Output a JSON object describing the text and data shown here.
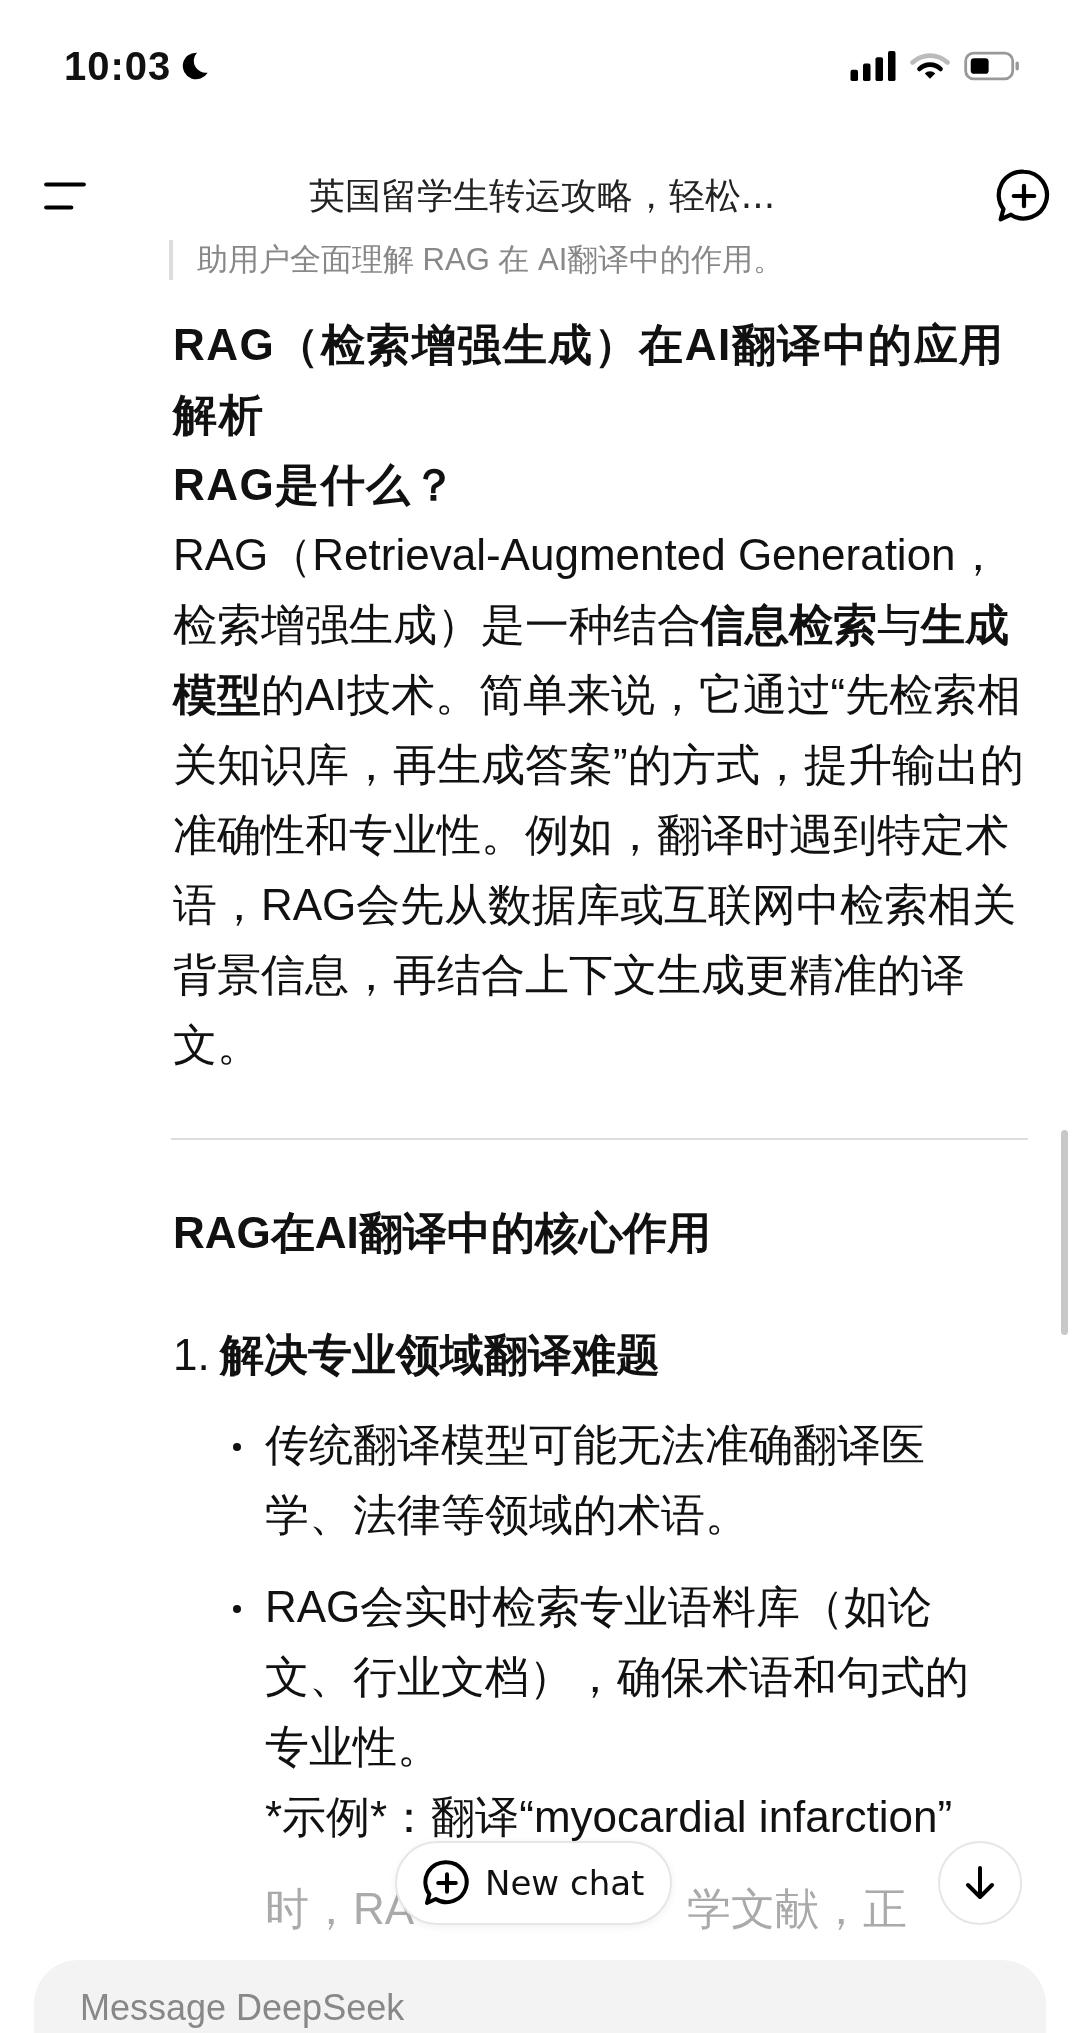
{
  "status_bar": {
    "time": "10:03",
    "do_not_disturb": true
  },
  "header": {
    "title": "英国留学生转运攻略，轻松..."
  },
  "blocks": [
    {
      "kind": "quote",
      "text": "助用户全面理解 RAG 在 AI翻译中的作用。"
    },
    {
      "kind": "heading",
      "text": "RAG（检索增强生成）在AI翻译中的应用解析"
    },
    {
      "kind": "heading",
      "text": "RAG是什么？"
    },
    {
      "kind": "paragraph",
      "text": "RAG（Retrieval-Augmented Generation，检索增强生成）是一种结合**信息检索**与**生成模型**的AI技术。简单来说，它通过“先检索相关知识库，再生成答案”的方式，提升输出的准确性和专业性。例如，翻译时遇到特定术语，RAG会先从数据库或互联网中检索相关背景信息，再结合上下文生成更精准的译文。"
    },
    {
      "kind": "divider"
    },
    {
      "kind": "section",
      "text": "RAG在AI翻译中的核心作用"
    },
    {
      "kind": "numbered",
      "number": "1.",
      "text": "解决专业领域翻译难题"
    },
    {
      "kind": "bullet",
      "text": "传统翻译模型可能无法准确翻译医学、法律等领域的术语。"
    },
    {
      "kind": "bullet",
      "text": "RAG会实时检索专业语料库（如论文、行业文档），确保术语和句式的专业性。",
      "extra": "*示例*：翻译“myocardial infarction”"
    },
    {
      "kind": "faded",
      "parts": [
        "时，RA",
        "学文献，正"
      ]
    }
  ],
  "new_chat_button": {
    "label": "New chat"
  },
  "composer": {
    "placeholder": "Message DeepSeek"
  }
}
